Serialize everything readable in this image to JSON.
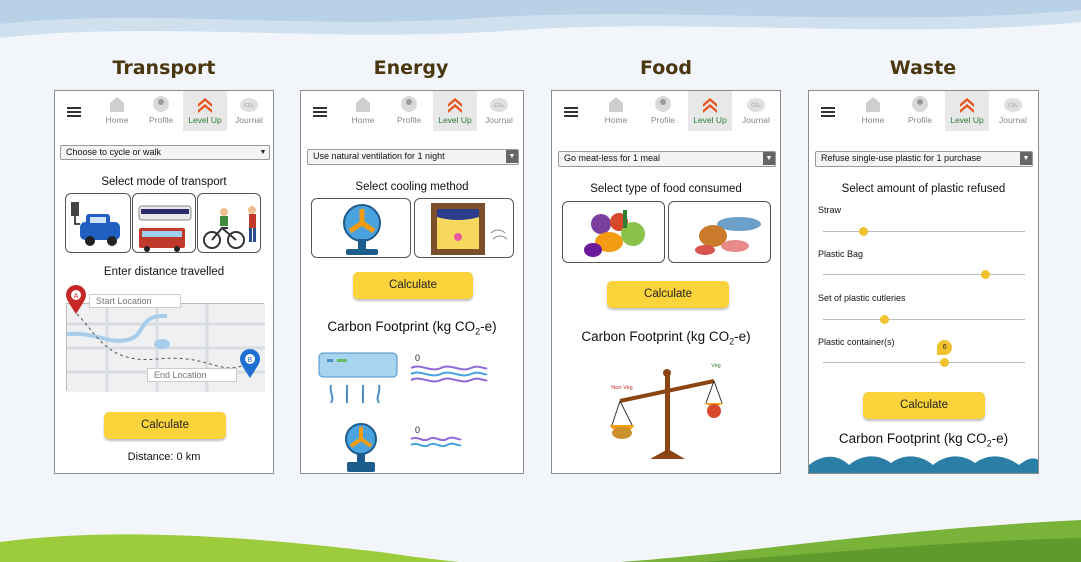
{
  "colors": {
    "accent": "#fbd33a",
    "active_nav": "#2e7d32",
    "title": "#4a3710"
  },
  "nav": {
    "home": "Home",
    "profile": "Profile",
    "level_up": "Level Up",
    "journal": "Journal",
    "co2_icon_text": "CO₂"
  },
  "transport": {
    "title": "Transport",
    "dropdown": "Choose to cycle or walk",
    "heading": "Select mode of transport",
    "distance_heading": "Enter distance travelled",
    "start_placeholder": "Start Location",
    "end_placeholder": "End Location",
    "marker_a": "A",
    "marker_b": "B",
    "calculate": "Calculate",
    "distance": "Distance: 0 km"
  },
  "energy": {
    "title": "Energy",
    "dropdown": "Use natural ventilation for 1 night",
    "heading": "Select cooling method",
    "calculate": "Calculate",
    "carbon_main": "Carbon Footprint (kg CO",
    "carbon_sub": "2",
    "carbon_end": "-e)",
    "value_aircon": "0",
    "value_fan": "0"
  },
  "food": {
    "title": "Food",
    "dropdown": "Go meat-less for 1 meal",
    "heading": "Select type of food consumed",
    "calculate": "Calculate",
    "carbon_main": "Carbon Footprint (kg CO",
    "carbon_sub": "2",
    "carbon_end": "-e)",
    "non_veg": "Non-Veg",
    "veg": "Veg"
  },
  "waste": {
    "title": "Waste",
    "dropdown": "Refuse single-use plastic for 1 purchase",
    "heading": "Select amount of plastic refused",
    "sliders": [
      {
        "label": "Straw",
        "value": 0.2
      },
      {
        "label": "Plastic Bag",
        "value": 0.8
      },
      {
        "label": "Set of plastic cutleries",
        "value": 0.3
      },
      {
        "label": "Plastic container(s)",
        "value": 0.6,
        "badge": "6"
      }
    ],
    "calculate": "Calculate",
    "carbon_main": "Carbon Footprint (kg CO",
    "carbon_sub": "2",
    "carbon_end": "-e)"
  }
}
